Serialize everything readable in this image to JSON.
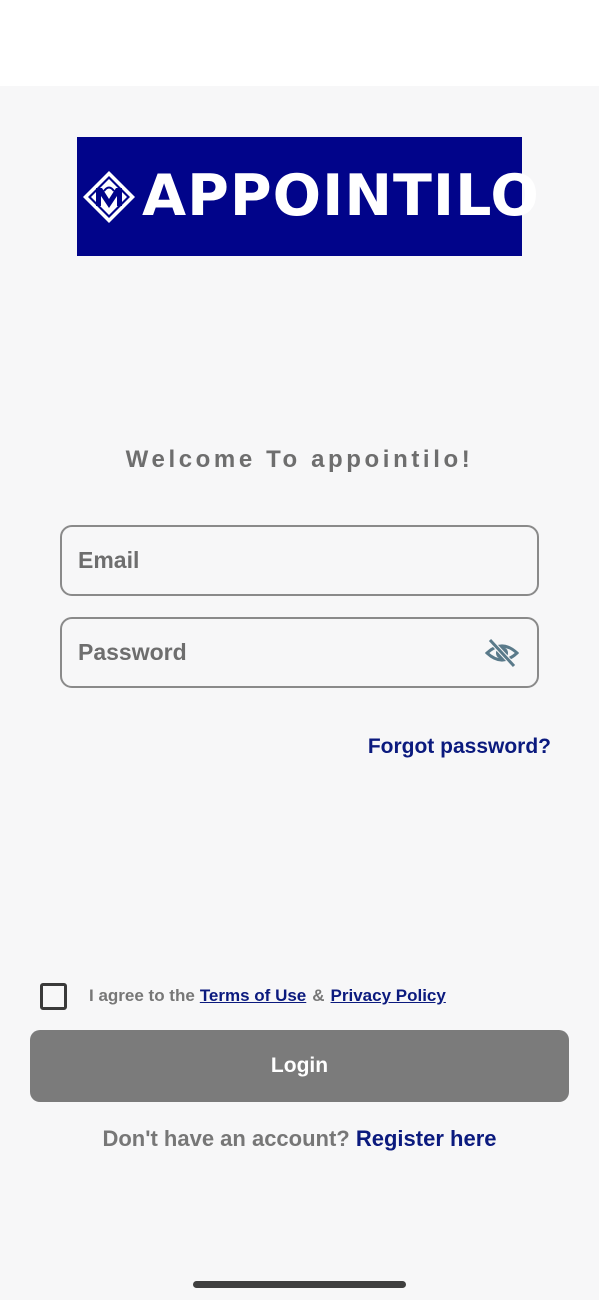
{
  "brand": {
    "logo_text": "APPOINTILO",
    "logo_background": "#01048a",
    "logo_icon": "monogram-diamond-icon"
  },
  "welcome": {
    "text": "Welcome To appointilo!"
  },
  "form": {
    "email_placeholder": "Email",
    "email_value": "",
    "password_placeholder": "Password",
    "password_value": "",
    "password_toggle_icon": "eye-off-icon",
    "forgot_label": "Forgot password?"
  },
  "agreement": {
    "checked": false,
    "prefix": "I agree to the",
    "terms_label": "Terms of Use",
    "separator": "&",
    "privacy_label": "Privacy Policy"
  },
  "login": {
    "label": "Login",
    "color": "#7b7b7b"
  },
  "register": {
    "prompt": "Don't have an account?",
    "link_label": "Register here"
  },
  "colors": {
    "accent": "#0b1a7e",
    "background": "#f7f7f8",
    "muted_text": "#6e6e6e"
  }
}
